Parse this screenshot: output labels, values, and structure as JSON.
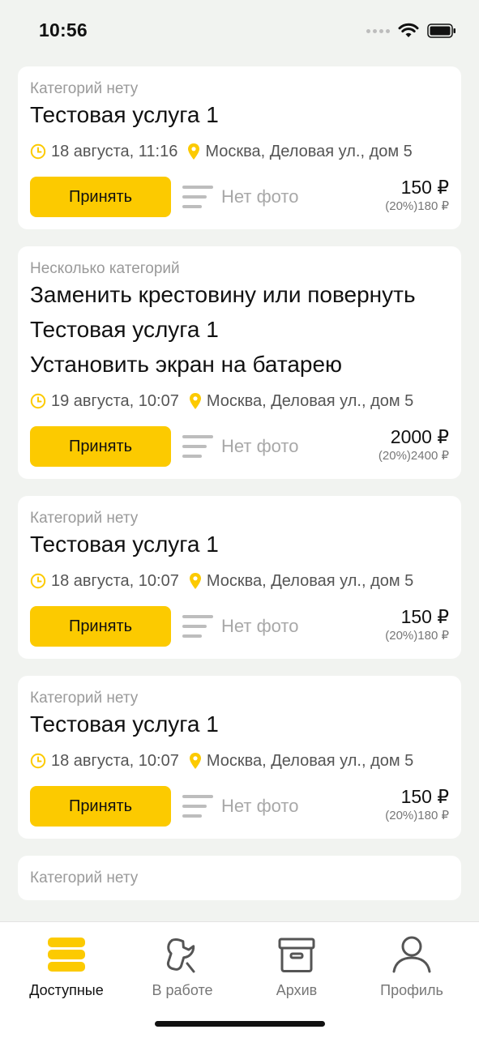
{
  "status_bar": {
    "time": "10:56"
  },
  "orders": [
    {
      "category": "Категорий нету",
      "titles": [
        "Тестовая услуга 1"
      ],
      "date": "18 августа, 11:16",
      "address": "Москва, Деловая ул., дом 5",
      "accept_label": "Принять",
      "photo_label": "Нет фото",
      "price": "150 ₽",
      "price_sub": "(20%)180 ₽"
    },
    {
      "category": "Несколько категорий",
      "titles": [
        "Заменить крестовину или повернуть",
        "Тестовая услуга 1",
        "Установить экран на батарею"
      ],
      "date": "19 августа, 10:07",
      "address": "Москва, Деловая ул., дом 5",
      "accept_label": "Принять",
      "photo_label": "Нет фото",
      "price": "2000 ₽",
      "price_sub": "(20%)2400 ₽"
    },
    {
      "category": "Категорий нету",
      "titles": [
        "Тестовая услуга 1"
      ],
      "date": "18 августа, 10:07",
      "address": "Москва, Деловая ул., дом 5",
      "accept_label": "Принять",
      "photo_label": "Нет фото",
      "price": "150 ₽",
      "price_sub": "(20%)180 ₽"
    },
    {
      "category": "Категорий нету",
      "titles": [
        "Тестовая услуга 1"
      ],
      "date": "18 августа, 10:07",
      "address": "Москва, Деловая ул., дом 5",
      "accept_label": "Принять",
      "photo_label": "Нет фото",
      "price": "150 ₽",
      "price_sub": "(20%)180 ₽"
    },
    {
      "category": "Категорий нету",
      "titles": [],
      "date": "",
      "address": "",
      "accept_label": "",
      "photo_label": "",
      "price": "",
      "price_sub": ""
    }
  ],
  "tabs": [
    {
      "label": "Доступные",
      "icon": "stack-icon",
      "active": true
    },
    {
      "label": "В работе",
      "icon": "wrench-icon",
      "active": false
    },
    {
      "label": "Архив",
      "icon": "archive-box-icon",
      "active": false
    },
    {
      "label": "Профиль",
      "icon": "person-icon",
      "active": false
    }
  ],
  "colors": {
    "accent": "#fcca00",
    "background": "#f1f3f0",
    "muted_text": "#9a9a9a"
  }
}
